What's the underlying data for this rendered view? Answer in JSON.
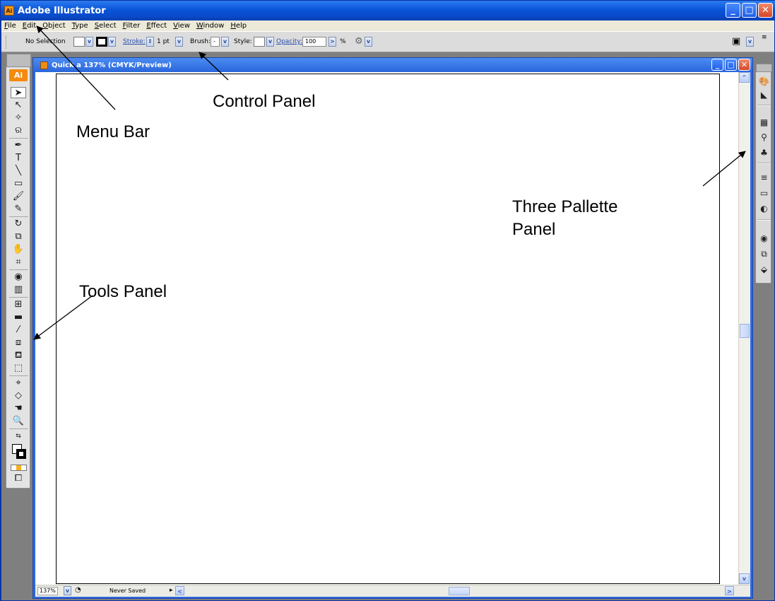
{
  "app": {
    "title": "Adobe Illustrator",
    "logo_text": "Ai"
  },
  "menu": [
    "File",
    "Edit",
    "Object",
    "Type",
    "Select",
    "Filter",
    "Effect",
    "View",
    "Window",
    "Help"
  ],
  "control_panel": {
    "selection": "No Selection",
    "stroke_label": "Stroke:",
    "stroke_value": "1 pt",
    "brush_label": "Brush:",
    "brush_value": "-",
    "style_label": "Style:",
    "opacity_label": "Opacity:",
    "opacity_value": "100",
    "percent": "%"
  },
  "document": {
    "title": "Quick a 137% (CMYK/Preview)",
    "zoom": "137%",
    "save_status": "Never Saved"
  },
  "tools_panel": {
    "badge": "Ai"
  },
  "annotations": {
    "menu_bar": "Menu Bar",
    "control_panel": "Control Panel",
    "tools_panel": "Tools Panel",
    "palette_line1": "Three Pallette",
    "palette_line2": "Panel"
  },
  "colors": {
    "title_blue": "#0a55d8",
    "panel_gray": "#e3e3e3",
    "workspace_gray": "#7f7f7f",
    "ai_orange": "#f58a0e"
  }
}
